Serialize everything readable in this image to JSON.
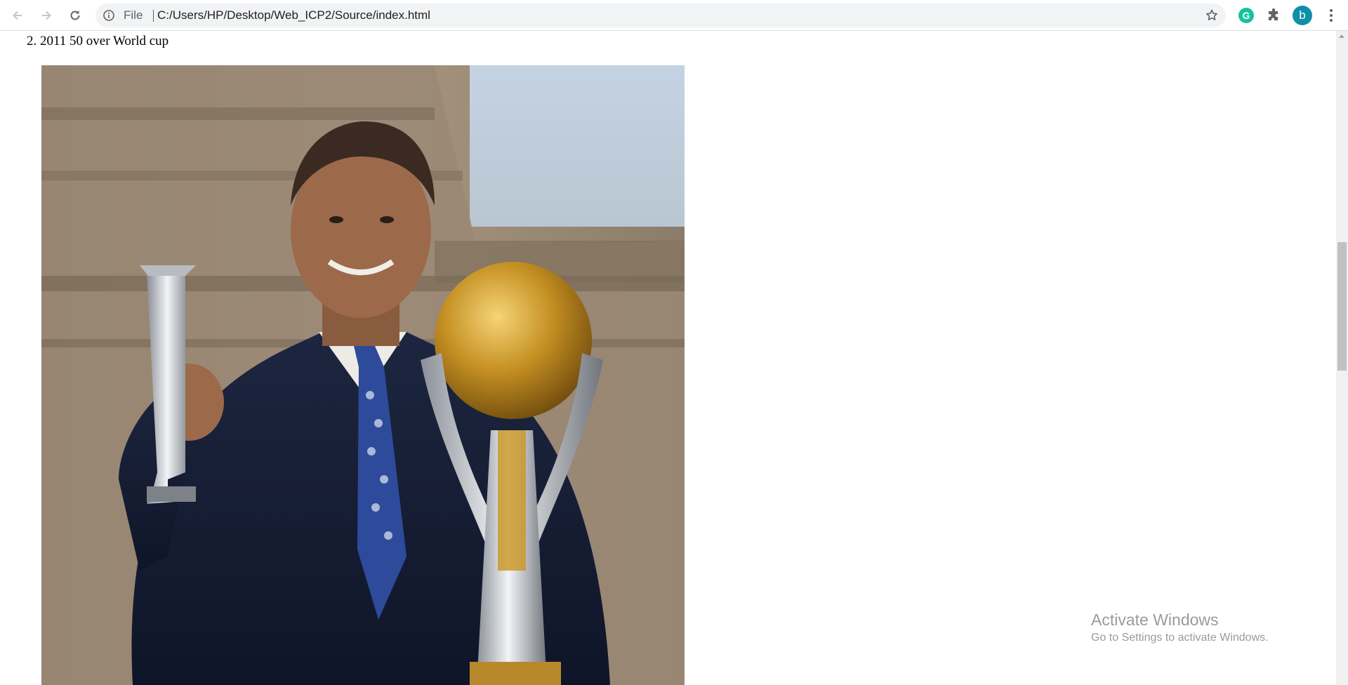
{
  "browser": {
    "url_scheme": "File",
    "url": "C:/Users/HP/Desktop/Web_ICP2/Source/index.html",
    "profile_initial": "b",
    "grammarly_letter": "G",
    "colors": {
      "toolbar_bg": "#ffffff",
      "omnibox_bg": "#f1f3f4",
      "grammarly": "#15c39a",
      "avatar": "#0f8fa8"
    },
    "icons": {
      "back": "arrow-left-icon",
      "forward": "arrow-right-icon",
      "reload": "reload-icon",
      "site_info": "info-icon",
      "bookmark": "star-icon",
      "grammarly": "grammarly-icon",
      "extensions": "puzzle-icon",
      "menu": "kebab-menu-icon"
    }
  },
  "page": {
    "list_item": "2. 2011 50 over World cup",
    "image_subject": "photo"
  },
  "watermark": {
    "title": "Activate Windows",
    "subtitle": "Go to Settings to activate Windows."
  }
}
